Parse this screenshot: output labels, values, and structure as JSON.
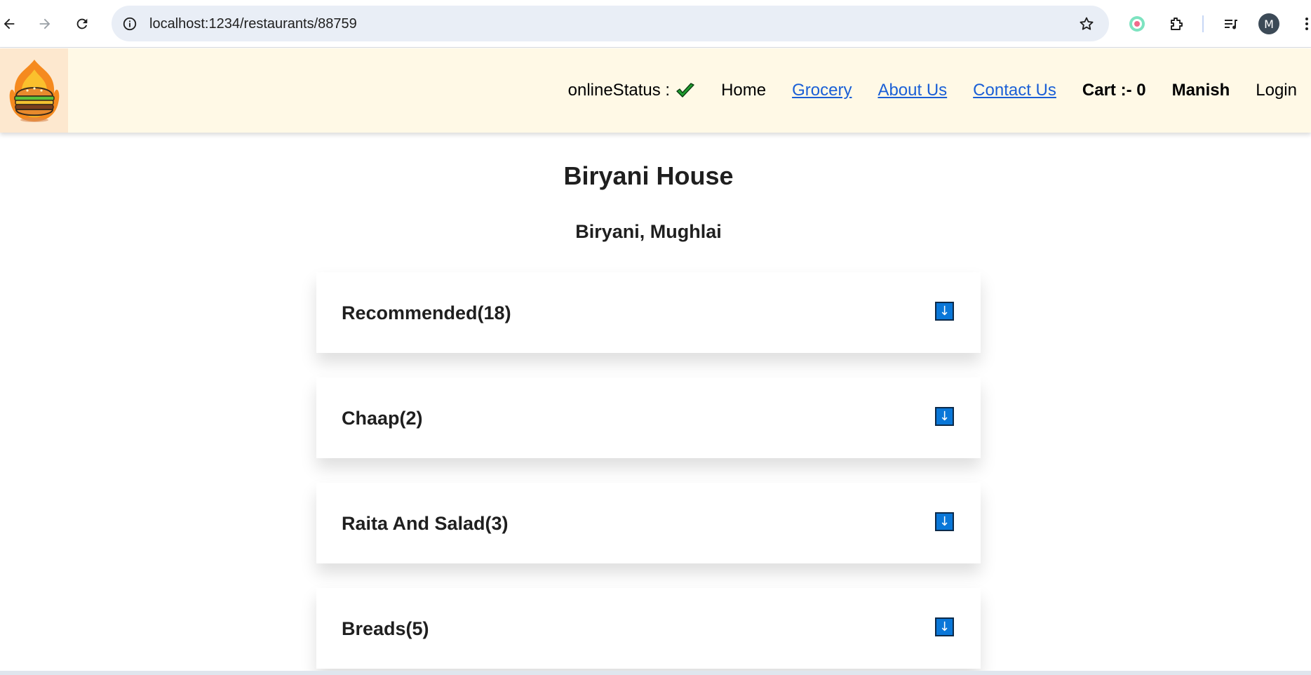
{
  "browser": {
    "url": "localhost:1234/restaurants/88759",
    "avatar_letter": "M"
  },
  "header": {
    "online_status_label": "onlineStatus :",
    "nav": {
      "home": "Home",
      "grocery": "Grocery",
      "about": "About Us",
      "contact": "Contact Us",
      "cart": "Cart :- 0",
      "user": "Manish",
      "login": "Login"
    }
  },
  "restaurant": {
    "name": "Biryani House",
    "cuisines": "Biryani, Mughlai"
  },
  "categories": [
    {
      "title": "Recommended(18)",
      "toggle": "↓"
    },
    {
      "title": "Chaap(2)",
      "toggle": "↓"
    },
    {
      "title": "Raita And Salad(3)",
      "toggle": "↓"
    },
    {
      "title": "Breads(5)",
      "toggle": "↓"
    }
  ],
  "colors": {
    "header_bg": "#fff9e6",
    "toggle_blue": "#0a77d8",
    "link_blue": "#1a5fd6",
    "status_check": "#1f9d2e"
  }
}
